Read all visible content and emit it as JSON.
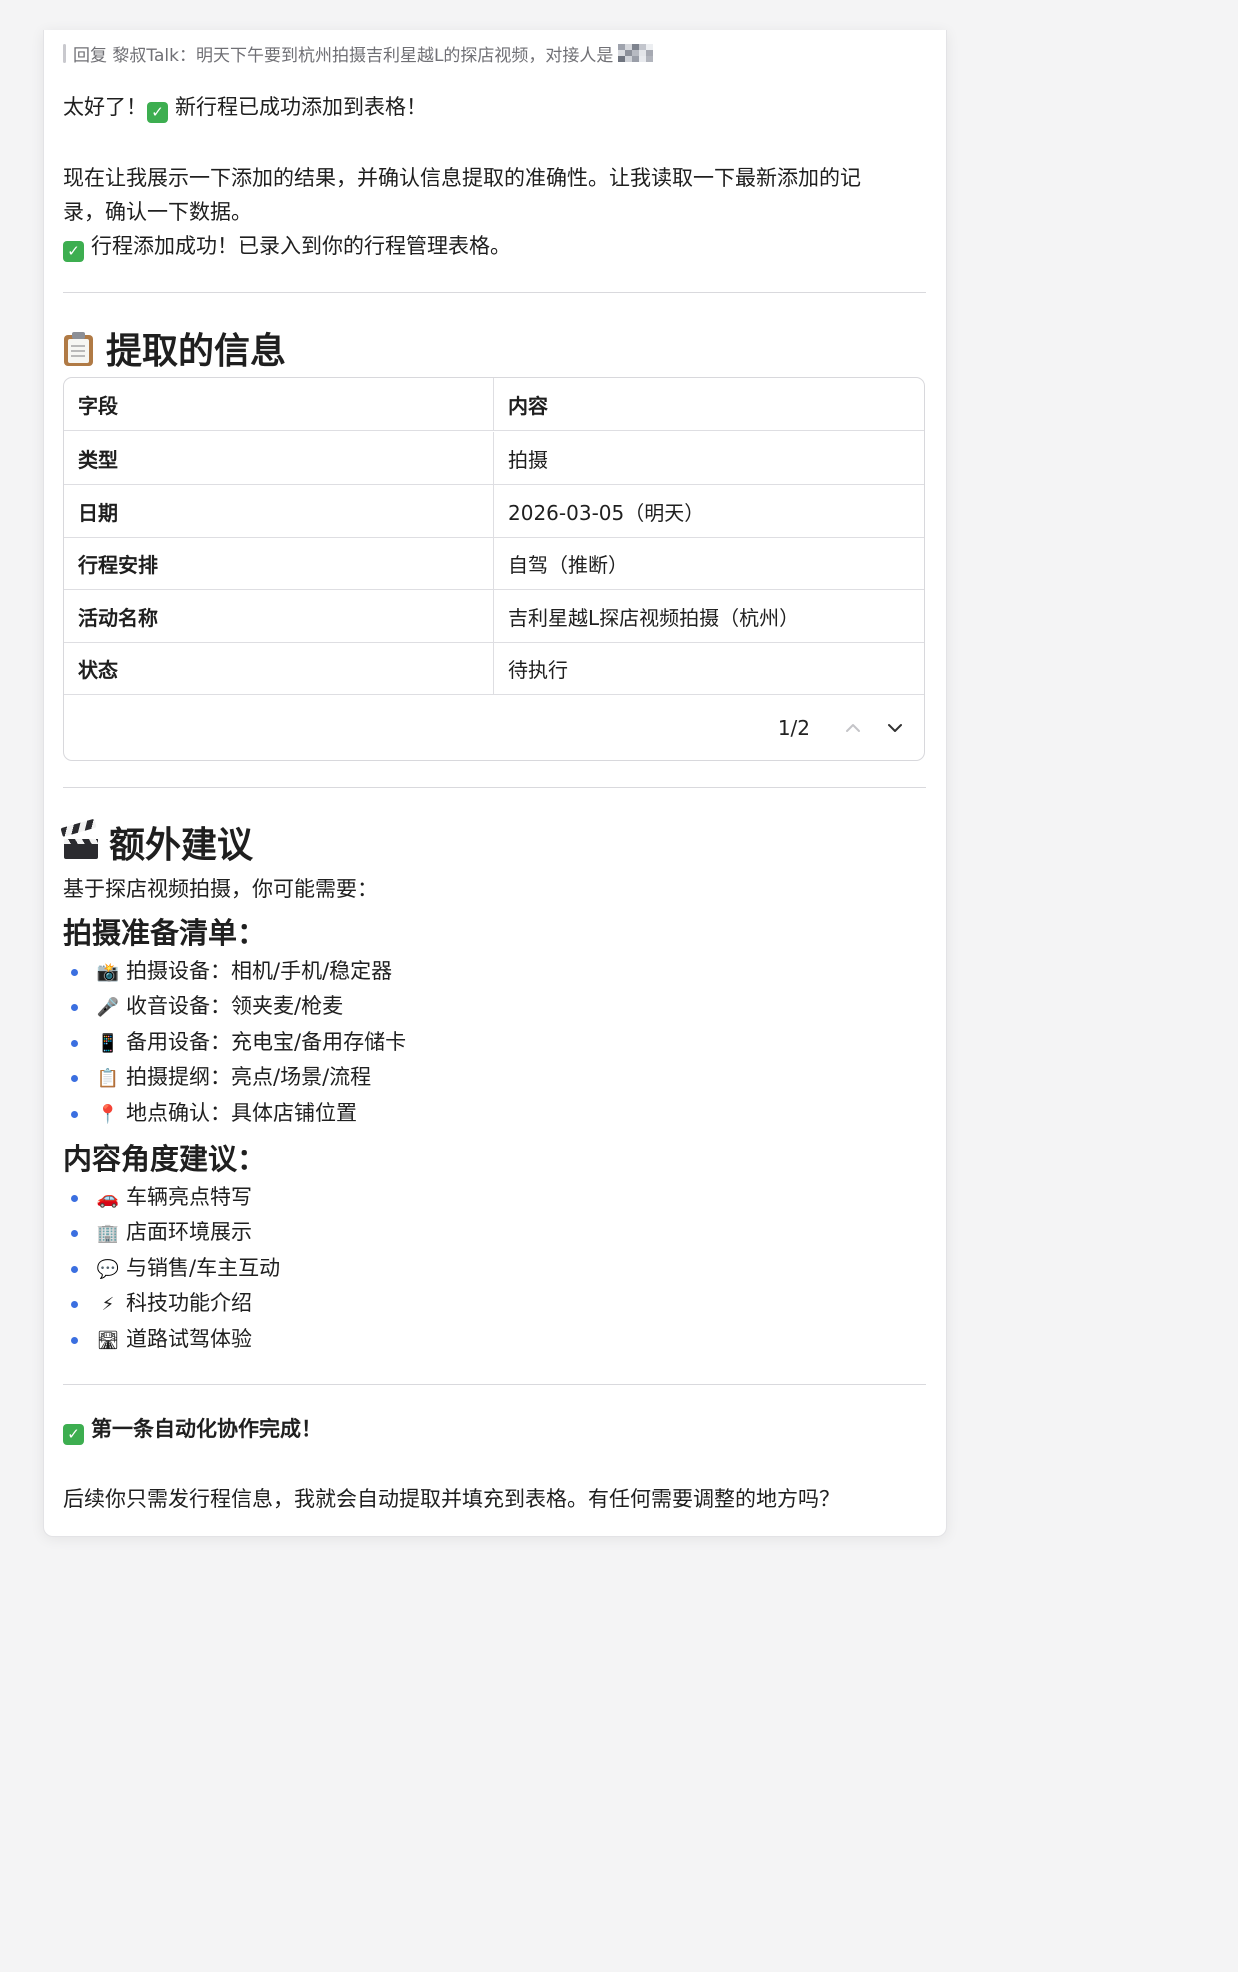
{
  "reply": {
    "prefix": "回复 黎叔Talk：明天下午要到杭州拍摄吉利星越L的探店视频，对接人是"
  },
  "intro": {
    "line1": "太好了！",
    "line1_rest": "新行程已成功添加到表格！",
    "para_a": "现在让我展示一下添加的结果，并确认信息提取的准确性。让我读取一下最新添加的记",
    "para_b": "录，确认一下数据。",
    "line3": "行程添加成功！已录入到你的行程管理表格。"
  },
  "section1": {
    "title": "提取的信息",
    "icon": "clipboard-icon",
    "table": {
      "headers": [
        "字段",
        "内容"
      ],
      "rows": [
        [
          "类型",
          "拍摄"
        ],
        [
          "日期",
          "2026-03-05（明天）"
        ],
        [
          "行程安排",
          "自驾（推断）"
        ],
        [
          "活动名称",
          "吉利星越L探店视频拍摄（杭州）"
        ],
        [
          "状态",
          "待执行"
        ]
      ],
      "pager": "1/2"
    }
  },
  "section2": {
    "title": "额外建议",
    "icon": "clapper-board-icon",
    "lead": "基于探店视频拍摄，你可能需要：",
    "sub1": "拍摄准备清单：",
    "list1": [
      {
        "emoji": "📸",
        "icon": "camera-flash-icon",
        "text": "拍摄设备：相机/手机/稳定器"
      },
      {
        "emoji": "🎤",
        "icon": "microphone-icon",
        "text": "收音设备：领夹麦/枪麦"
      },
      {
        "emoji": "📱",
        "icon": "mobile-phone-icon",
        "text": "备用设备：充电宝/备用存储卡"
      },
      {
        "emoji": "📋",
        "icon": "clipboard-icon",
        "text": "拍摄提纲：亮点/场景/流程"
      },
      {
        "emoji": "📍",
        "icon": "round-pushpin-icon",
        "text": "地点确认：具体店铺位置"
      }
    ],
    "sub2": "内容角度建议：",
    "list2": [
      {
        "emoji": "🚗",
        "icon": "car-icon",
        "text": "车辆亮点特写"
      },
      {
        "emoji": "🏢",
        "icon": "office-building-icon",
        "text": "店面环境展示"
      },
      {
        "emoji": "💬",
        "icon": "speech-bubble-icon",
        "text": "与销售/车主互动"
      },
      {
        "emoji": "⚡",
        "icon": "lightning-icon",
        "text": "科技功能介绍"
      },
      {
        "emoji": "🛣",
        "icon": "motorway-icon",
        "text": "道路试驾体验"
      }
    ]
  },
  "footer": {
    "done": "第一条自动化协作完成！",
    "tail": "后续你只需发行程信息，我就会自动提取并填充到表格。有任何需要调整的地方吗？"
  },
  "colors": {
    "check": "#3dae50",
    "bullet": "#3b6fe0",
    "divider": "#d9d9dd"
  }
}
